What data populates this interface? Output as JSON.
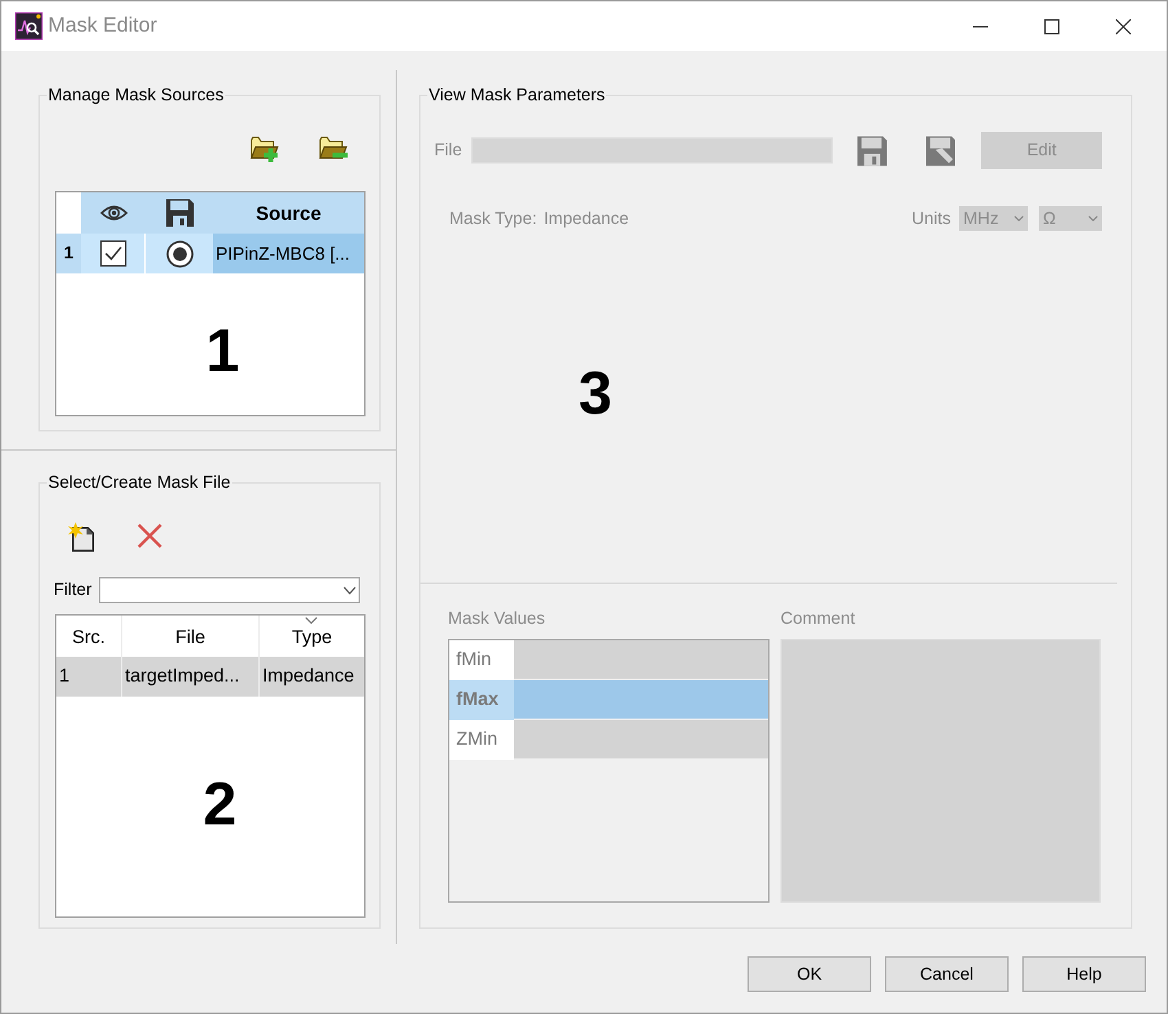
{
  "window": {
    "title": "Mask Editor"
  },
  "sources_panel": {
    "title": "Manage Mask Sources",
    "columns": [
      "Source"
    ],
    "rows": [
      {
        "index": "1",
        "visible": true,
        "active": true,
        "source": "PIPinZ-MBC8 [...",
        "selected": true
      }
    ],
    "marker": "1"
  },
  "file_panel": {
    "title": "Select/Create Mask File",
    "filter_label": "Filter",
    "columns": [
      "Src.",
      "File",
      "Type"
    ],
    "rows": [
      {
        "src": "1",
        "file": "targetImped...",
        "type": "Impedance",
        "selected": true
      }
    ],
    "marker": "2"
  },
  "params_panel": {
    "title": "View Mask Parameters",
    "file_label": "File",
    "edit_button": {
      "label": "Edit",
      "disabled": true
    },
    "mask_type_label": "Mask Type:",
    "mask_type": "Impedance",
    "units_label": "Units",
    "units": [
      "MHz",
      "Ω"
    ],
    "marker": "3",
    "values_label": "Mask Values",
    "values": [
      {
        "name": "fMin",
        "selected": false
      },
      {
        "name": "fMax",
        "selected": true
      },
      {
        "name": "ZMin",
        "selected": false
      }
    ],
    "comment_label": "Comment"
  },
  "buttons": [
    "OK",
    "Cancel",
    "Help"
  ]
}
